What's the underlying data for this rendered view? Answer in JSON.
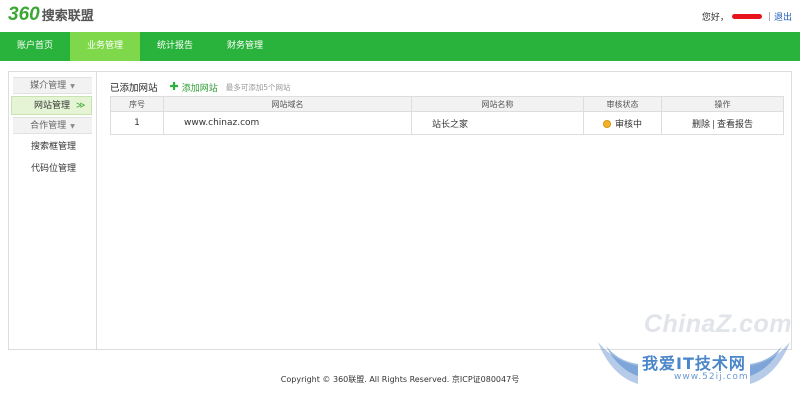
{
  "header": {
    "logo_number": "360",
    "logo_text": "搜索联盟",
    "greeting": "您好，",
    "separator": "|",
    "logout": "退出"
  },
  "nav": {
    "items": [
      {
        "label": "账户首页",
        "active": false
      },
      {
        "label": "业务管理",
        "active": true
      },
      {
        "label": "统计报告",
        "active": false
      },
      {
        "label": "财务管理",
        "active": false
      }
    ]
  },
  "sidebar": {
    "media_group": "媒介管理",
    "website_management": "网站管理",
    "active_chevron": "≫",
    "partner_group": "合作管理",
    "search_box_management": "搜索框管理",
    "code_slot_management": "代码位管理"
  },
  "content": {
    "title": "已添加网站",
    "add_site": "添加网站",
    "hint": "最多可添加5个网站",
    "columns": {
      "index": "序号",
      "domain": "网站域名",
      "name": "网站名称",
      "status": "审核状态",
      "ops": "操作"
    },
    "rows": [
      {
        "index": "1",
        "domain": "www.chinaz.com",
        "name": "站长之家",
        "status": "审核中",
        "op_delete": "删除",
        "op_sep": "|",
        "op_report": "查看报告"
      }
    ]
  },
  "footer": {
    "copyright": "Copyright © 360联盟. All Rights Reserved. 京ICP证080047号"
  },
  "watermark": {
    "brand": "ChinaZ.com",
    "site": "我爱IT技术网",
    "url": "www.52ij.com"
  },
  "colors": {
    "brand_green": "#2ab33c",
    "nav_active": "#7fd84a",
    "logout_blue": "#1a5bb8"
  }
}
